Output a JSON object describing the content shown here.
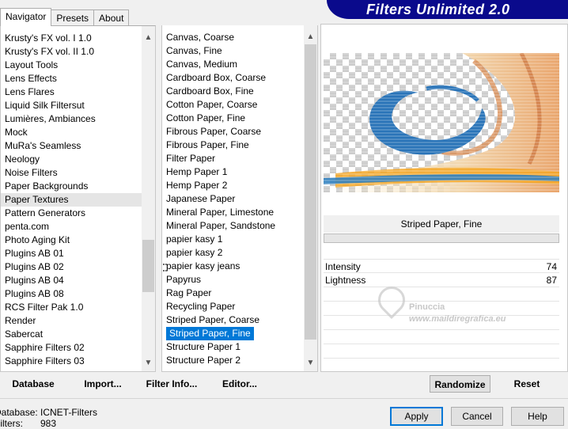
{
  "tabs": [
    "Navigator",
    "Presets",
    "About"
  ],
  "title": "Filters Unlimited 2.0",
  "categories": [
    "Krusty's FX vol. I 1.0",
    "Krusty's FX vol. II 1.0",
    "Layout Tools",
    "Lens Effects",
    "Lens Flares",
    "Liquid Silk Filtersut",
    "Lumières, Ambiances",
    "Mock",
    "MuRa's Seamless",
    "Neology",
    "Noise Filters",
    "Paper Backgrounds",
    "Paper Textures",
    "Pattern Generators",
    "penta.com",
    "Photo Aging Kit",
    "Plugins AB 01",
    "Plugins AB 02",
    "Plugins AB 04",
    "Plugins AB 08",
    "RCS Filter Pak 1.0",
    "Render",
    "Sabercat",
    "Sapphire Filters 02",
    "Sapphire Filters 03"
  ],
  "filters": [
    "Canvas, Coarse",
    "Canvas, Fine",
    "Canvas, Medium",
    "Cardboard Box, Coarse",
    "Cardboard Box, Fine",
    "Cotton Paper, Coarse",
    "Cotton Paper, Fine",
    "Fibrous Paper, Coarse",
    "Fibrous Paper, Fine",
    "Filter Paper",
    "Hemp Paper 1",
    "Hemp Paper 2",
    "Japanese Paper",
    "Mineral Paper, Limestone",
    "Mineral Paper, Sandstone",
    "papier kasy 1",
    "papier kasy 2",
    "papier kasy jeans",
    "Papyrus",
    "Rag Paper",
    "Recycling Paper",
    "Striped Paper, Coarse",
    "Striped Paper, Fine",
    "Structure Paper 1",
    "Structure Paper 2"
  ],
  "selected_filter": "Striped Paper, Fine",
  "filter_name": "Striped Paper, Fine",
  "params": [
    {
      "label": "Intensity",
      "value": "74"
    },
    {
      "label": "Lightness",
      "value": "87"
    }
  ],
  "watermark": {
    "line1": "Pinuccia",
    "line2": "www.maildiregrafica.eu"
  },
  "buttons": {
    "database": "Database",
    "import": "Import...",
    "filter_info": "Filter Info...",
    "editor": "Editor...",
    "randomize": "Randomize",
    "reset": "Reset",
    "apply": "Apply",
    "cancel": "Cancel",
    "help": "Help"
  },
  "status": {
    "db_label": "Database:",
    "db_value": "ICNET-Filters",
    "filters_label": "Filters:",
    "filters_value": "983"
  }
}
